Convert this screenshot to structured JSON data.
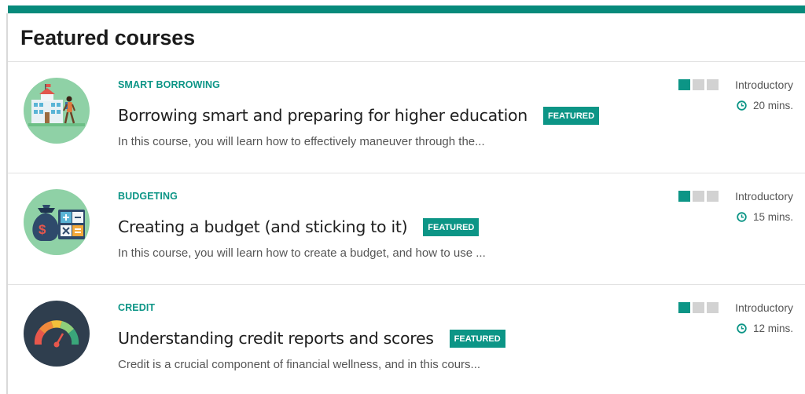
{
  "page_title": "Featured courses",
  "colors": {
    "accent": "#0c9586",
    "topbar": "#078a7b",
    "bar_off": "#d2d2d2"
  },
  "courses": [
    {
      "category": "SMART BORROWING",
      "title": "Borrowing smart and preparing for higher education",
      "badge": "FEATURED",
      "description": "In this course, you will learn how to effectively maneuver through the...",
      "level": "Introductory",
      "level_value": 1,
      "level_max": 3,
      "duration": "20 mins.",
      "icon": "school-building-icon"
    },
    {
      "category": "BUDGETING",
      "title": "Creating a budget (and sticking to it)",
      "badge": "FEATURED",
      "description": "In this course, you will learn how to create a budget, and how to use ...",
      "level": "Introductory",
      "level_value": 1,
      "level_max": 3,
      "duration": "15 mins.",
      "icon": "money-bag-calculator-icon"
    },
    {
      "category": "CREDIT",
      "title": "Understanding credit reports and scores",
      "badge": "FEATURED",
      "description": "Credit is a crucial component of financial wellness, and in this cours...",
      "level": "Introductory",
      "level_value": 1,
      "level_max": 3,
      "duration": "12 mins.",
      "icon": "credit-gauge-icon"
    }
  ]
}
